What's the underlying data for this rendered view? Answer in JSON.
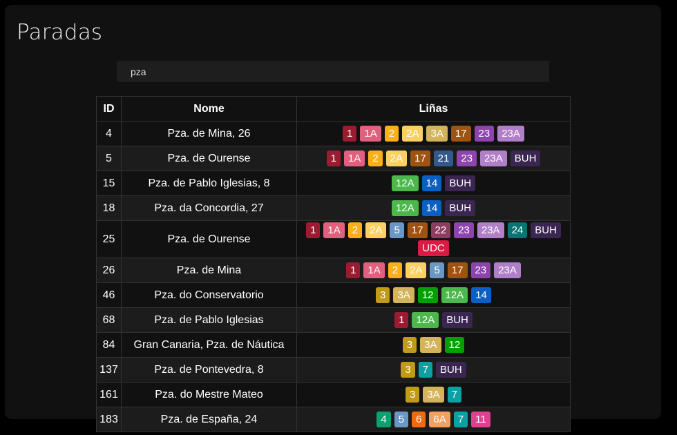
{
  "title": "Paradas",
  "search": {
    "value": "pza"
  },
  "table": {
    "headers": {
      "id": "ID",
      "nome": "Nome",
      "linas": "Liñas"
    },
    "rows": [
      {
        "id": "4",
        "nome": "Pza. de Mina, 26",
        "lines": [
          "1",
          "1A",
          "2",
          "2A",
          "3A",
          "17",
          "23",
          "23A"
        ]
      },
      {
        "id": "5",
        "nome": "Pza. de Ourense",
        "lines": [
          "1",
          "1A",
          "2",
          "2A",
          "17",
          "21",
          "23",
          "23A",
          "BUH"
        ]
      },
      {
        "id": "15",
        "nome": "Pza. de Pablo Iglesias, 8",
        "lines": [
          "12A",
          "14",
          "BUH"
        ]
      },
      {
        "id": "18",
        "nome": "Pza. da Concordia, 27",
        "lines": [
          "12A",
          "14",
          "BUH"
        ]
      },
      {
        "id": "25",
        "nome": "Pza. de Ourense",
        "lines": [
          "1",
          "1A",
          "2",
          "2A",
          "5",
          "17",
          "22",
          "23",
          "23A",
          "24",
          "BUH",
          "UDC"
        ]
      },
      {
        "id": "26",
        "nome": "Pza. de Mina",
        "lines": [
          "1",
          "1A",
          "2",
          "2A",
          "5",
          "17",
          "23",
          "23A"
        ]
      },
      {
        "id": "46",
        "nome": "Pza. do Conservatorio",
        "lines": [
          "3",
          "3A",
          "12",
          "12A",
          "14"
        ]
      },
      {
        "id": "68",
        "nome": "Pza. de Pablo Iglesias",
        "lines": [
          "1",
          "12A",
          "BUH"
        ]
      },
      {
        "id": "84",
        "nome": "Gran Canaria, Pza. de Náutica",
        "lines": [
          "3",
          "3A",
          "12"
        ]
      },
      {
        "id": "137",
        "nome": "Pza. de Pontevedra, 8",
        "lines": [
          "3",
          "7",
          "BUH"
        ]
      },
      {
        "id": "161",
        "nome": "Pza. do Mestre Mateo",
        "lines": [
          "3",
          "3A",
          "7"
        ]
      },
      {
        "id": "183",
        "nome": "Pza. de España, 24",
        "lines": [
          "4",
          "5",
          "6",
          "6A",
          "7",
          "11"
        ]
      }
    ]
  },
  "line_colors": {
    "1": "#9b1c31",
    "1A": "#e0607e",
    "2": "#fbb01a",
    "2A": "#fcd062",
    "3": "#c19a17",
    "3A": "#d4b45a",
    "4": "#0aa070",
    "5": "#6a97c4",
    "6": "#f06a10",
    "6A": "#f0a060",
    "7": "#0aa0a4",
    "11": "#e04090",
    "12": "#00a000",
    "12A": "#4cb84c",
    "14": "#0a5fc4",
    "17": "#9e5312",
    "21": "#33598a",
    "22": "#8c3d62",
    "23": "#8e44ad",
    "23A": "#b07fc8",
    "24": "#0b7373",
    "BUH": "#3a2650",
    "UDC": "#d91c43"
  }
}
